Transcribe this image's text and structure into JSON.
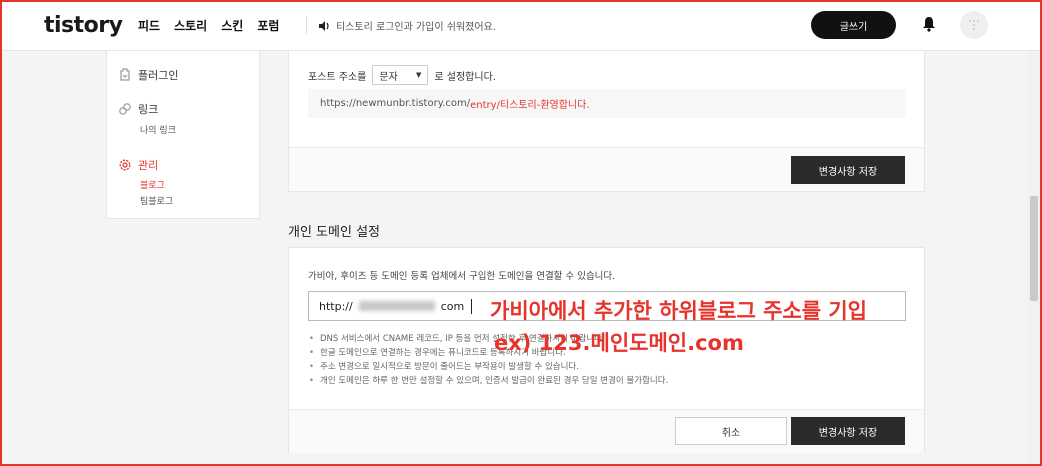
{
  "header": {
    "logo": "tistory",
    "nav": [
      "피드",
      "스토리",
      "스킨",
      "포럼"
    ],
    "notice": "티스토리 로그인과 가입이 쉬워졌어요.",
    "write_button": "글쓰기"
  },
  "sidebar": {
    "items": [
      {
        "label": "플러그인",
        "icon": "plugin-icon"
      },
      {
        "label": "링크",
        "icon": "link-icon",
        "sub": [
          "나의 링크"
        ]
      },
      {
        "label": "관리",
        "icon": "gear-icon",
        "sub": [
          "블로그",
          "팀블로그"
        ]
      }
    ]
  },
  "post_address": {
    "label_prefix": "포스트 주소를",
    "select_value": "문자",
    "label_suffix": "로 설정합니다.",
    "url_base": "https://newmunbr.tistory.com/",
    "url_highlight": "entry/티스토리-환영합니다.",
    "save_button": "변경사항 저장"
  },
  "domain": {
    "title": "개인 도메인 설정",
    "description": "가비아, 후이즈 등 도메인 등록 업체에서 구입한 도메인을 연결할 수 있습니다.",
    "input_prefix": "http://",
    "input_suffix": "com",
    "notes": [
      "DNS 서비스에서 CNAME 레코드, IP 등을 먼저 설정한 후 연결하시기 바랍니다.",
      "한글 도메인으로 연결하는 경우에는 퓨니코드로 등록하시기 바랍니다.",
      "주소 변경으로 일시적으로 방문이 줄어드는 부작용이 발생할 수 있습니다.",
      "개인 도메인은 하루 한 번만 설정할 수 있으며, 인증서 발급이 완료된 경우 당일 변경이 불가합니다."
    ],
    "cancel_button": "취소",
    "save_button": "변경사항 저장"
  },
  "annotation": {
    "line1": "가비아에서 추가한 하위블로그 주소를 기입",
    "line2": "ex) 123.메인도메인.com"
  },
  "colors": {
    "accent": "#e6342c",
    "dark_button": "#2b2b2b"
  }
}
